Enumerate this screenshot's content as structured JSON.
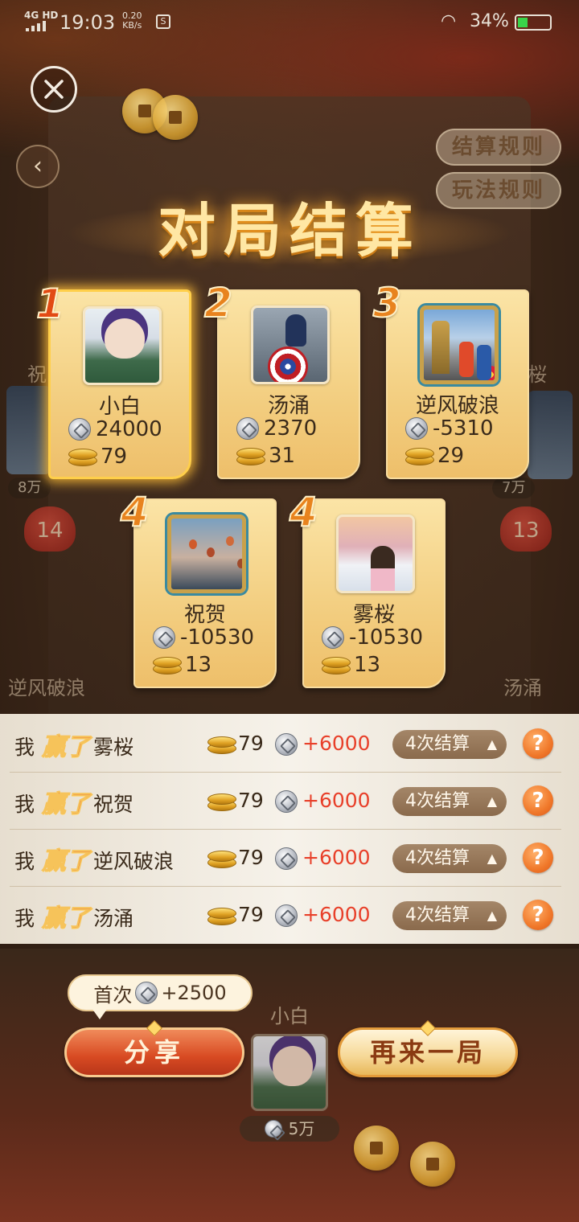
{
  "status_bar": {
    "network": "4G HD",
    "time": "19:03",
    "speed_value": "0.20",
    "speed_unit": "KB/s",
    "battery_percent": "34%",
    "battery_level": 0.34
  },
  "top": {
    "settle_rules_label": "结算规则",
    "play_rules_label": "玩法规则"
  },
  "title": "对局结算",
  "players": [
    {
      "rank": "1",
      "name": "小白",
      "silver": "24000",
      "gold": "79",
      "winner": true
    },
    {
      "rank": "2",
      "name": "汤涌",
      "silver": "2370",
      "gold": "31",
      "winner": false
    },
    {
      "rank": "3",
      "name": "逆风破浪",
      "silver": "-5310",
      "gold": "29",
      "winner": false
    },
    {
      "rank": "4",
      "name": "祝贺",
      "silver": "-10530",
      "gold": "13",
      "winner": false
    },
    {
      "rank": "4",
      "name": "雾桜",
      "silver": "-10530",
      "gold": "13",
      "winner": false
    }
  ],
  "settlements": [
    {
      "me": "我",
      "result": "赢了",
      "opponent": "雾桜",
      "gold": "79",
      "silver": "+6000",
      "times": "4次结算"
    },
    {
      "me": "我",
      "result": "赢了",
      "opponent": "祝贺",
      "gold": "79",
      "silver": "+6000",
      "times": "4次结算"
    },
    {
      "me": "我",
      "result": "赢了",
      "opponent": "逆风破浪",
      "gold": "79",
      "silver": "+6000",
      "times": "4次结算"
    },
    {
      "me": "我",
      "result": "赢了",
      "opponent": "汤涌",
      "gold": "79",
      "silver": "+6000",
      "times": "4次结算"
    }
  ],
  "background_seats": {
    "left_name": "祝",
    "right_name": "桜",
    "left_chip": "8万",
    "right_chip": "7万",
    "left_bag": "14",
    "right_bag": "13",
    "lower_left_name": "逆风破浪",
    "lower_right_name": "汤涌",
    "self_name": "小白",
    "self_chip": "5万"
  },
  "bottom": {
    "first_share_prefix": "首次",
    "first_share_reward": "+2500",
    "share_label": "分享",
    "again_label": "再来一局"
  },
  "help_icon_text": "?",
  "colors": {
    "accent_win": "#e0401a",
    "positive_value": "#e8402a",
    "card_gold": "#f3cf82",
    "title_glow": "#ffe7a4"
  }
}
